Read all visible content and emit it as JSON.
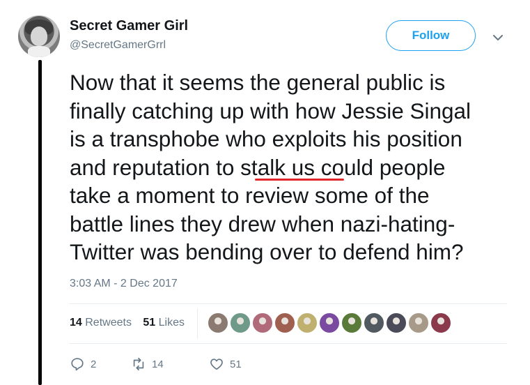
{
  "author": {
    "display_name": "Secret Gamer Girl",
    "handle": "@SecretGamerGrrl"
  },
  "header": {
    "follow_label": "Follow"
  },
  "tweet": {
    "lines": [
      "Now that it seems the general public is",
      "finally catching up with how Jessie Singal",
      "is a transphobe who exploits his position",
      "and reputation to stalk us could people",
      "take a moment to review some of the",
      "battle lines they drew when nazi-hating-",
      "Twitter was bending over to defend him?"
    ],
    "timestamp": "3:03 AM - 2 Dec 2017",
    "annotation_color": "#e0262a"
  },
  "stats": {
    "retweets_count": "14",
    "retweets_label": "Retweets",
    "likes_count": "51",
    "likes_label": "Likes"
  },
  "likers": [
    {
      "icon": "liker-avatar-1",
      "color": "#8a7a70"
    },
    {
      "icon": "liker-avatar-2",
      "color": "#6f9a8a"
    },
    {
      "icon": "liker-avatar-3",
      "color": "#b06a7a"
    },
    {
      "icon": "liker-avatar-4",
      "color": "#a06050"
    },
    {
      "icon": "liker-avatar-5",
      "color": "#c0b070"
    },
    {
      "icon": "liker-avatar-6",
      "color": "#7a4aa0"
    },
    {
      "icon": "liker-avatar-7",
      "color": "#5a7a3a"
    },
    {
      "icon": "liker-avatar-8",
      "color": "#505a60"
    },
    {
      "icon": "liker-avatar-9",
      "color": "#4a4a58"
    },
    {
      "icon": "liker-avatar-10",
      "color": "#a89a88"
    },
    {
      "icon": "liker-avatar-11",
      "color": "#8a3a4a"
    }
  ],
  "actions": {
    "reply_count": "2",
    "retweet_count": "14",
    "like_count": "51"
  },
  "colors": {
    "accent": "#1da1f2",
    "secondary_text": "#657786",
    "primary_text": "#14171a"
  }
}
